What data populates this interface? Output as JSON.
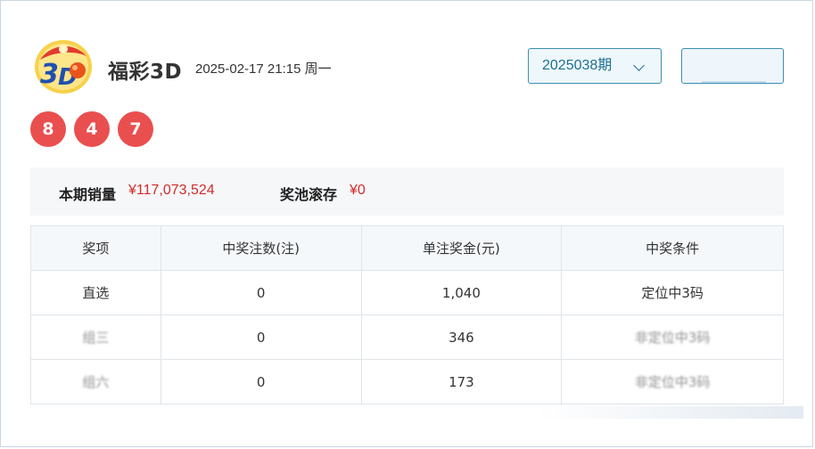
{
  "header": {
    "logo_icon": "fucai-3d-logo-icon",
    "title": "福彩3D",
    "datetime": "2025-02-17 21:15 周一",
    "period_label": "2025038期",
    "action_button_label": ""
  },
  "numbers": [
    "8",
    "4",
    "7"
  ],
  "summary": {
    "sales_label": "本期销量",
    "sales_value": "¥117,073,524",
    "pool_label": "奖池滚存",
    "pool_value": "¥0"
  },
  "table": {
    "headers": [
      "奖项",
      "中奖注数(注)",
      "单注奖金(元)",
      "中奖条件"
    ],
    "rows": [
      {
        "name": "直选",
        "count": "0",
        "amount": "1,040",
        "condition": "定位中3码"
      },
      {
        "name": "组三",
        "count": "0",
        "amount": "346",
        "condition": "非定位中3码"
      },
      {
        "name": "组六",
        "count": "0",
        "amount": "173",
        "condition": "非定位中3码"
      }
    ]
  },
  "colors": {
    "ball": "#ea4f4f",
    "money": "#d42b2b",
    "accent": "#1d6f93"
  }
}
